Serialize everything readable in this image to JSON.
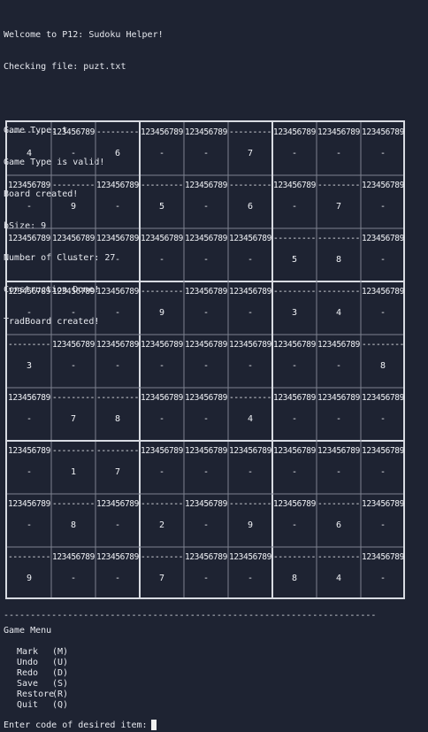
{
  "terminal": {
    "top_rule": "----------------------------------------------------------------------",
    "log_lines": [
      "Welcome to P12: Sudoku Helper!",
      "Checking file: puzt.txt",
      "",
      "Game Type: t",
      "Game Type is valid!",
      "Board created!",
      "bSize: 9",
      "Number of Cluster: 27",
      "Construction Done!",
      "TradBoard created!"
    ],
    "mid_rule": "----------------------------------------------------------------------",
    "menu_title": "Game Menu",
    "menu_items": [
      {
        "label": "Mark",
        "code": "(M)"
      },
      {
        "label": "Undo",
        "code": "(U)"
      },
      {
        "label": "Redo",
        "code": "(D)"
      },
      {
        "label": "Save",
        "code": "(S)"
      },
      {
        "label": "Restore",
        "code": "(R)"
      },
      {
        "label": "Quit",
        "code": "(Q)"
      }
    ],
    "prompt": "Enter code of desired item:"
  },
  "board": {
    "size": 9,
    "full_candidates": "123456789",
    "empty_candidates": "---------",
    "empty_value": "-",
    "rows": [
      [
        "4",
        "-",
        "6",
        "-",
        "-",
        "7",
        "-",
        "-",
        "-"
      ],
      [
        "-",
        "9",
        "-",
        "5",
        "-",
        "6",
        "-",
        "7",
        "-"
      ],
      [
        "-",
        "-",
        "-",
        "-",
        "-",
        "-",
        "5",
        "8",
        "-"
      ],
      [
        "-",
        "-",
        "-",
        "9",
        "-",
        "-",
        "3",
        "4",
        "-"
      ],
      [
        "3",
        "-",
        "-",
        "-",
        "-",
        "-",
        "-",
        "-",
        "8"
      ],
      [
        "-",
        "7",
        "8",
        "-",
        "-",
        "4",
        "-",
        "-",
        "-"
      ],
      [
        "-",
        "1",
        "7",
        "-",
        "-",
        "-",
        "-",
        "-",
        "-"
      ],
      [
        "-",
        "8",
        "-",
        "2",
        "-",
        "9",
        "-",
        "6",
        "-"
      ],
      [
        "9",
        "-",
        "-",
        "7",
        "-",
        "-",
        "8",
        "4",
        "-"
      ]
    ]
  }
}
